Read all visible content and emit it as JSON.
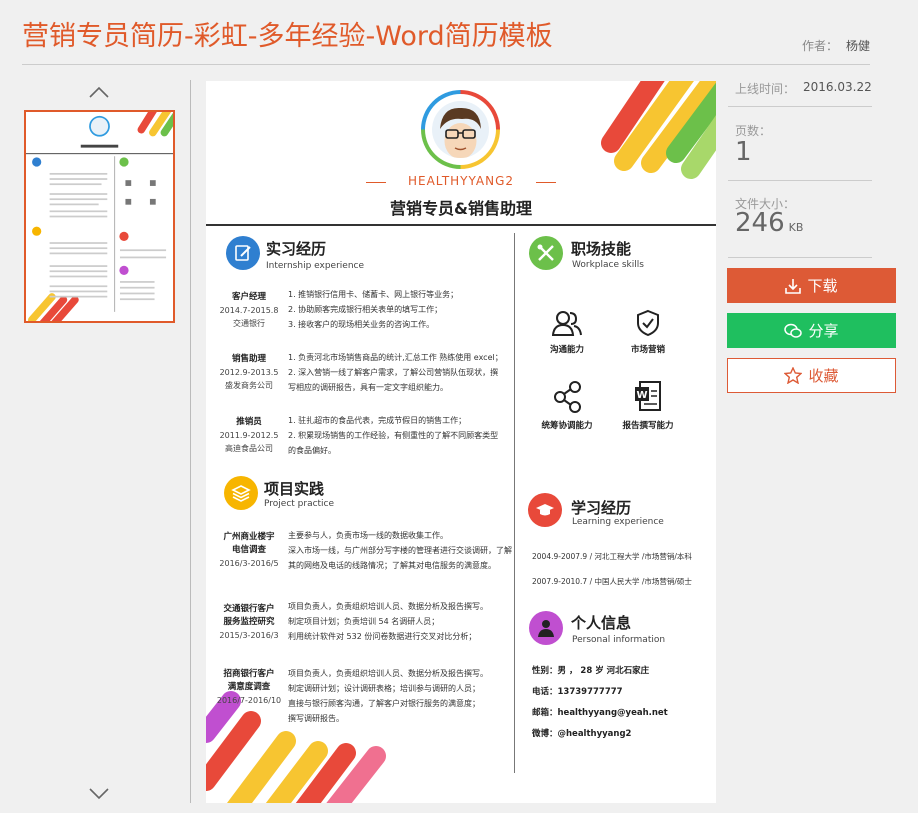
{
  "header": {
    "title": "营销专员简历-彩虹-多年经验-Word简历模板",
    "author_label": "作者：",
    "author_name": "杨健"
  },
  "thumbnails": {
    "up_icon": "chevron-up-icon",
    "down_icon": "chevron-down-icon"
  },
  "resume": {
    "name": "HEALTHYYANG2",
    "job_title": "营销专员&销售助理",
    "internship": {
      "title": "实习经历",
      "subtitle": "Internship experience",
      "entries": [
        {
          "role": "客户经理",
          "period": "2014.7-2015.8",
          "company": "交通银行",
          "lines": [
            "1. 推销银行信用卡、储蓄卡、网上银行等业务；",
            "2. 协助顾客完成银行相关表单的填写工作；",
            "3. 接收客户的现场相关业务的咨询工作。"
          ]
        },
        {
          "role": "销售助理",
          "period": "2012.9-2013.5",
          "company": "盛发商务公司",
          "lines": [
            "1. 负责河北市场销售商品的统计,汇总工作 熟练使用 excel；",
            "2. 深入营销一线了解客户需求，了解公司营销队伍现状，撰",
            "写相应的调研报告，具有一定文字组织能力。"
          ]
        },
        {
          "role": "推销员",
          "period": "2011.9-2012.5",
          "company": "高迪食品公司",
          "lines": [
            "1. 驻扎超市的食品代表，完成节假日的销售工作；",
            "2. 积累现场销售的工作经验，有侧重性的了解不同顾客类型",
            "的食品偏好。"
          ]
        }
      ]
    },
    "projects": {
      "title": "项目实践",
      "subtitle": "Project practice",
      "entries": [
        {
          "role1": "广州商业楼宇",
          "role2": "电信调查",
          "period": "2016/3-2016/5",
          "lines": [
            "主要参与人，负责市场一线的数据收集工作。",
            "深入市场一线，与广州部分写字楼的管理者进行交谈调研，了解",
            "其的网络及电话的线路情况；了解其对电信服务的满意度。"
          ]
        },
        {
          "role1": "交通银行客户",
          "role2": "服务监控研究",
          "period": "2015/3-2016/3",
          "lines": [
            "项目负责人，负责组织培训人员、数据分析及报告撰写。",
            "制定项目计划；负责培训 54 名调研人员；",
            "利用统计软件对 532 份问卷数据进行交叉对比分析；"
          ]
        },
        {
          "role1": "招商银行客户",
          "role2": "满意度调查",
          "period": "2016/7-2016/10",
          "lines": [
            "项目负责人，负责组织培训人员、数据分析及报告撰写。",
            "制定调研计划；设计调研表格；培训参与调研的人员；",
            "直接与银行顾客沟通，了解客户对银行服务的满意度；",
            "撰写调研报告。"
          ]
        }
      ]
    },
    "skills": {
      "title": "职场技能",
      "subtitle": "Workplace skills",
      "items": [
        {
          "label": "沟通能力",
          "icon": "people-icon"
        },
        {
          "label": "市场营销",
          "icon": "shield-check-icon"
        },
        {
          "label": "统筹协调能力",
          "icon": "share-nodes-icon"
        },
        {
          "label": "报告撰写能力",
          "icon": "word-document-icon"
        }
      ]
    },
    "education": {
      "title": "学习经历",
      "subtitle": "Learning experience",
      "entries": [
        "2004.9-2007.9 / 河北工程大学 /市场营销/本科",
        "2007.9-2010.7 / 中国人民大学 /市场营销/硕士"
      ]
    },
    "personal": {
      "title": "个人信息",
      "subtitle": "Personal information",
      "lines": [
        "性别：男 ， 28 岁   河北石家庄",
        "电话：13739777777",
        "邮箱：healthyyang@yeah.net",
        "微博：@healthyyang2"
      ]
    }
  },
  "sidebar": {
    "online_label": "上线时间：",
    "online_value": "2016.03.22",
    "pages_label": "页数：",
    "pages_value": "1",
    "size_label": "文件大小：",
    "size_value": "246",
    "size_unit": "KB",
    "download": "下载",
    "share": "分享",
    "favorite": "收藏"
  },
  "colors": {
    "accent": "#dd5a36",
    "share_green": "#1fbf5f",
    "title_orange": "#e05a2a"
  }
}
